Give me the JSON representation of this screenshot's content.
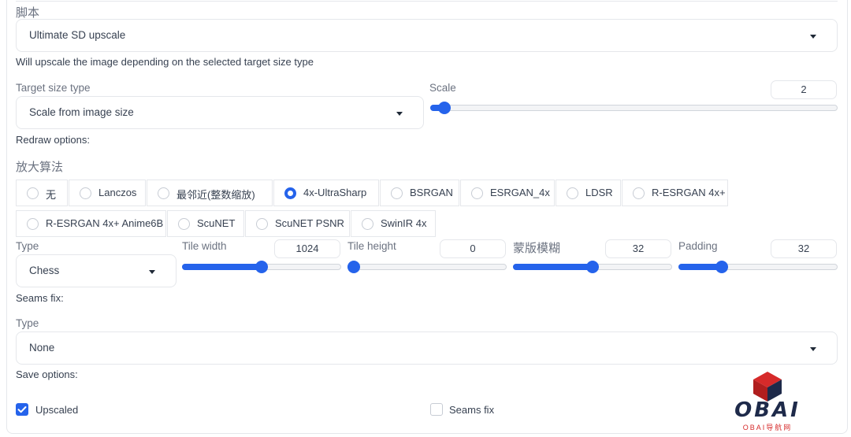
{
  "script": {
    "label": "脚本",
    "selected": "Ultimate SD upscale",
    "description": "Will upscale the image depending on the selected target size type"
  },
  "target_size": {
    "label": "Target size type",
    "selected": "Scale from image size"
  },
  "scale": {
    "label": "Scale",
    "value": "2",
    "fraction": 0.02
  },
  "redraw_label": "Redraw options:",
  "upscaler": {
    "label": "放大算法",
    "options": [
      "无",
      "Lanczos",
      "最邻近(整数缩放)",
      "4x-UltraSharp",
      "BSRGAN",
      "ESRGAN_4x",
      "LDSR",
      "R-ESRGAN 4x+",
      "R-ESRGAN 4x+ Anime6B",
      "ScuNET",
      "ScuNET PSNR",
      "SwinIR 4x"
    ],
    "selected": "4x-UltraSharp"
  },
  "type": {
    "label": "Type",
    "selected": "Chess"
  },
  "tile_width": {
    "label": "Tile width",
    "value": "1024",
    "fraction": 0.5
  },
  "tile_height": {
    "label": "Tile height",
    "value": "0",
    "fraction": 0.0
  },
  "mask_blur": {
    "label": "蒙版模糊",
    "value": "32",
    "fraction": 0.5
  },
  "padding": {
    "label": "Padding",
    "value": "32",
    "fraction": 0.25
  },
  "seams_fix": {
    "label": "Seams fix:",
    "type_label": "Type",
    "selected": "None"
  },
  "save_options": {
    "label": "Save options:",
    "upscaled": {
      "label": "Upscaled",
      "checked": true
    },
    "seams_fix": {
      "label": "Seams fix",
      "checked": false
    }
  },
  "watermark": {
    "brand": "OBAI",
    "tagline": "OBAI导航网"
  },
  "colors": {
    "accent": "#2563eb",
    "logo_red": "#d62a2a",
    "logo_navy": "#1e2a4a"
  }
}
